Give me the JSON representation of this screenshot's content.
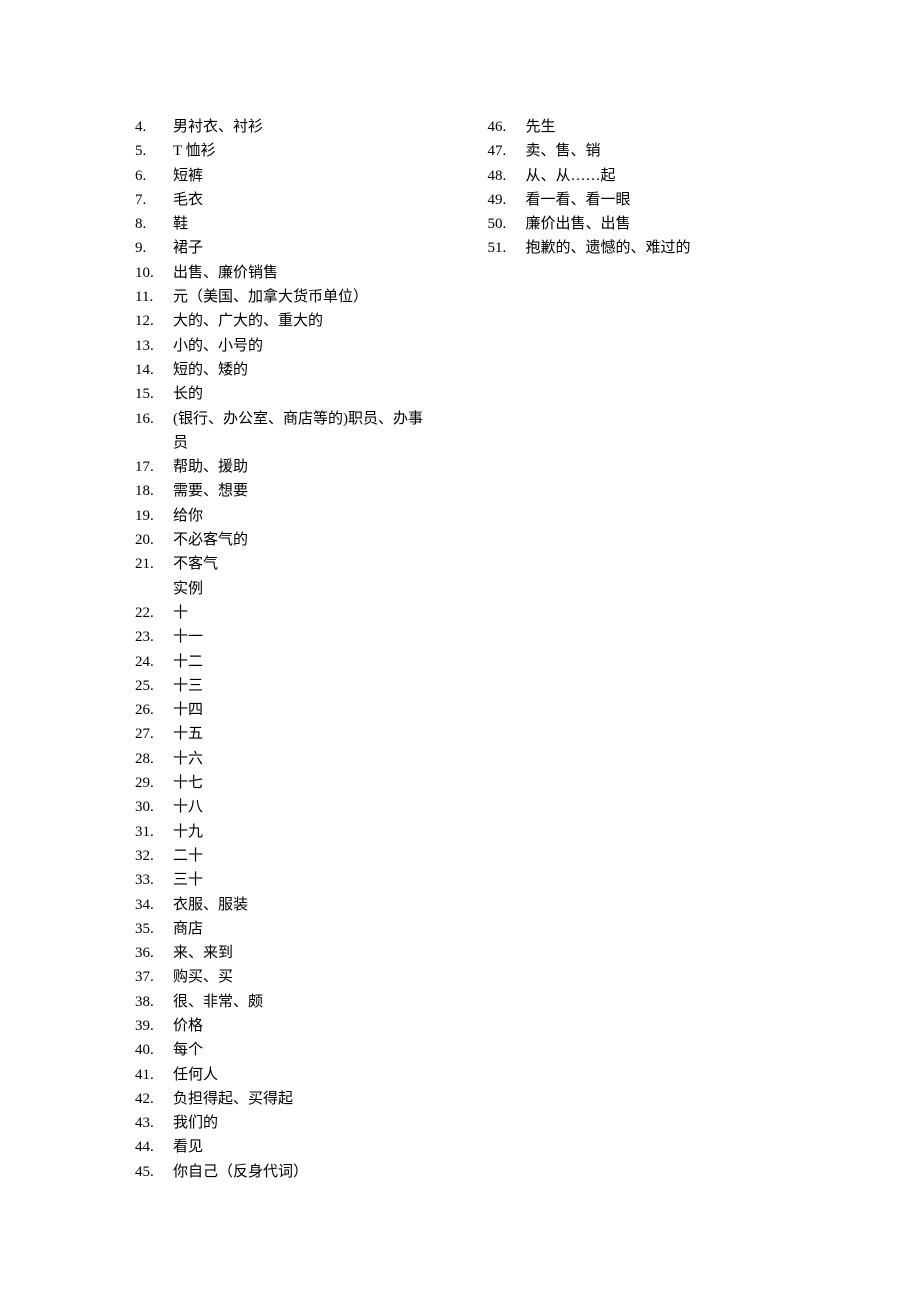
{
  "left_column": [
    {
      "num": "4.",
      "text": "男衬衣、衬衫"
    },
    {
      "num": "5.",
      "text": "T 恤衫"
    },
    {
      "num": "6.",
      "text": "短裤"
    },
    {
      "num": "7.",
      "text": "毛衣"
    },
    {
      "num": "8.",
      "text": "鞋"
    },
    {
      "num": "9.",
      "text": "裙子"
    },
    {
      "num": "10.",
      "text": "出售、廉价销售"
    },
    {
      "num": "11.",
      "text": "元（美国、加拿大货币单位）"
    },
    {
      "num": "12.",
      "text": "大的、广大的、重大的"
    },
    {
      "num": "13.",
      "text": "小的、小号的"
    },
    {
      "num": "14.",
      "text": "短的、矮的"
    },
    {
      "num": "15.",
      "text": "长的"
    },
    {
      "num": "16.",
      "text": "(银行、办公室、商店等的)职员、办事",
      "sub": "员"
    },
    {
      "num": "17.",
      "text": "帮助、援助"
    },
    {
      "num": "18.",
      "text": "需要、想要"
    },
    {
      "num": "19.",
      "text": "给你"
    },
    {
      "num": "20.",
      "text": "不必客气的"
    },
    {
      "num": "21.",
      "text": "不客气",
      "sub": "实例"
    },
    {
      "num": "22.",
      "text": "十"
    },
    {
      "num": "23.",
      "text": "十一"
    },
    {
      "num": "24.",
      "text": "十二"
    },
    {
      "num": "25.",
      "text": "十三"
    },
    {
      "num": "26.",
      "text": "十四"
    },
    {
      "num": "27.",
      "text": "十五"
    },
    {
      "num": "28.",
      "text": "十六"
    },
    {
      "num": "29.",
      "text": "十七"
    },
    {
      "num": "30.",
      "text": "十八"
    },
    {
      "num": "31.",
      "text": "十九"
    },
    {
      "num": "32.",
      "text": "二十"
    },
    {
      "num": "33.",
      "text": "三十"
    },
    {
      "num": "34.",
      "text": "衣服、服装"
    },
    {
      "num": "35.",
      "text": "商店"
    },
    {
      "num": "36.",
      "text": "来、来到"
    },
    {
      "num": "37.",
      "text": "购买、买"
    },
    {
      "num": "38.",
      "text": "很、非常、颇"
    },
    {
      "num": "39.",
      "text": "价格"
    },
    {
      "num": "40.",
      "text": "每个"
    },
    {
      "num": "41.",
      "text": "任何人"
    },
    {
      "num": "42.",
      "text": "负担得起、买得起"
    },
    {
      "num": "43.",
      "text": "我们的"
    },
    {
      "num": "44.",
      "text": "看见"
    },
    {
      "num": "45.",
      "text": "你自己（反身代词）"
    }
  ],
  "right_column": [
    {
      "num": "46.",
      "text": "先生"
    },
    {
      "num": "47.",
      "text": "卖、售、销"
    },
    {
      "num": "48.",
      "text": "从、从……起"
    },
    {
      "num": "49.",
      "text": "看一看、看一眼"
    },
    {
      "num": "50.",
      "text": "廉价出售、出售"
    },
    {
      "num": "51.",
      "text": "抱歉的、遗憾的、难过的"
    }
  ]
}
